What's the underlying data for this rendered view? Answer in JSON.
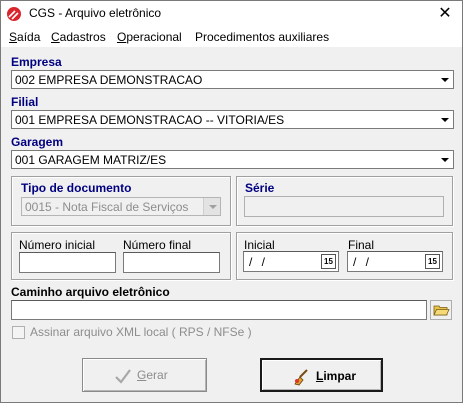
{
  "window": {
    "title": "CGS - Arquivo eletrônico",
    "close_glyph": "✕"
  },
  "menu": {
    "items": [
      {
        "label": "Saída",
        "accel": "S",
        "rest": "aída"
      },
      {
        "label": "Cadastros",
        "accel": "C",
        "rest": "adastros"
      },
      {
        "label": "Operacional",
        "accel": "O",
        "rest": "peracional"
      },
      {
        "label": "Procedimentos auxiliares",
        "accel": "",
        "rest": "Procedimentos auxiliares"
      }
    ]
  },
  "empresa": {
    "label": "Empresa",
    "value": "002 EMPRESA DEMONSTRACAO"
  },
  "filial": {
    "label": "Filial",
    "value": "001 EMPRESA DEMONSTRACAO -- VITORIA/ES"
  },
  "garagem": {
    "label": "Garagem",
    "value": "001 GARAGEM MATRIZ/ES"
  },
  "tipo_documento": {
    "label": "Tipo de documento",
    "value": "0015 - Nota Fiscal de Serviços"
  },
  "serie": {
    "label": "Série",
    "value": ""
  },
  "numero": {
    "inicial_label": "Número inicial",
    "inicial_value": "",
    "final_label": "Número final",
    "final_value": ""
  },
  "datas": {
    "inicial_label": "Inicial",
    "inicial_value": "/ /",
    "final_label": "Final",
    "final_value": "/ /",
    "calendar_glyph": "15"
  },
  "caminho": {
    "label": "Caminho arquivo eletrônico",
    "value": ""
  },
  "assinar": {
    "label": "Assinar arquivo XML local ( RPS / NFSe )",
    "checked": false
  },
  "buttons": {
    "gerar_accel": "G",
    "gerar_rest": "erar",
    "limpar_accel": "L",
    "limpar_rest": "impar"
  },
  "icons": {
    "app": "cgs-logo-icon",
    "close": "close-icon",
    "dropdown": "chevron-down-icon",
    "calendar": "calendar-icon",
    "folder": "folder-open-icon",
    "gerar": "check-mark-icon",
    "limpar": "broom-icon"
  }
}
